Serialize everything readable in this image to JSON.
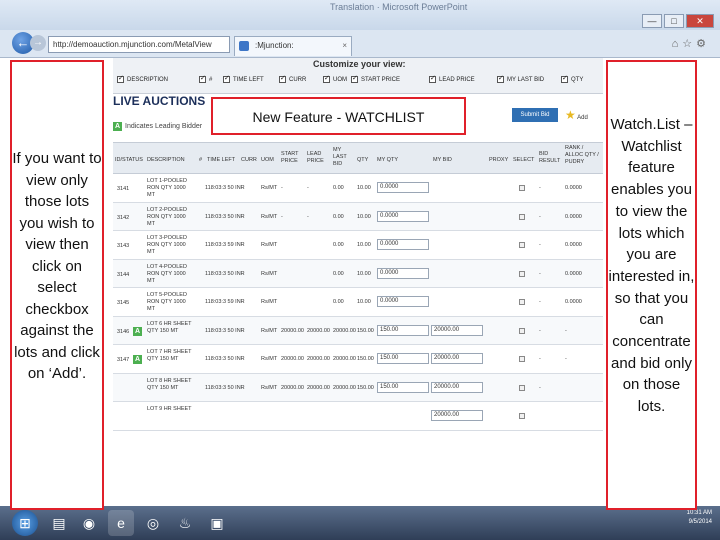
{
  "browser": {
    "window_title": "Translation · Microsoft PowerPoint",
    "address": "http://demoauction.mjunction.com/MetalView",
    "tab_title": ":Mjunction:",
    "win_min": "—",
    "win_max": "□",
    "win_close": "✕"
  },
  "customize": {
    "title": "Customize your view:",
    "options": [
      "DESCRIPTION",
      "#",
      "TIME LEFT",
      "CURR",
      "UOM",
      "START PRICE",
      "LEAD PRICE",
      "MY LAST BID",
      "QTY"
    ]
  },
  "page": {
    "live_auctions": "LIVE AUCTIONS",
    "leading_badge": "A",
    "indicates_leading": "Indicates Leading Bidder",
    "submit_bid": "Submit Bid",
    "add_label": "Add"
  },
  "table": {
    "headers": {
      "status": "ID/STATUS",
      "description": "DESCRIPTION",
      "hash": "#",
      "time_left": "TIME LEFT",
      "curr": "CURR",
      "uom": "UOM",
      "start_price": "START PRICE",
      "lead_price": "LEAD PRICE",
      "my_last_bid": "MY LAST BID",
      "qty": "QTY",
      "my_qty": "MY QTY",
      "my_bid": "MY BID",
      "proxy": "PROXY",
      "select": "SELECT",
      "bid_result": "BID RESULT",
      "rank": "RANK / ALLOC QTY / PUDRY"
    },
    "rows": [
      {
        "id": "3141",
        "badge": "",
        "desc1": "LOT 1-POOLED",
        "desc2": "RON QTY 1000",
        "desc3": "MT",
        "time": "118:03:3 50 INR",
        "uom": "Rs/MT",
        "start": "-",
        "lead": "-",
        "last": "0.00",
        "qty": "10.00",
        "myqty": "0.0000",
        "mybid": "",
        "result": "-",
        "rank": "0.0000"
      },
      {
        "id": "3142",
        "badge": "",
        "desc1": "LOT 2-POOLED",
        "desc2": "RON QTY 1000",
        "desc3": "MT",
        "time": "118:03:3 50 INR",
        "uom": "Rs/MT",
        "start": "-",
        "lead": "-",
        "last": "0.00",
        "qty": "10.00",
        "myqty": "0.0000",
        "mybid": "",
        "result": "-",
        "rank": "0.0000"
      },
      {
        "id": "3143",
        "badge": "",
        "desc1": "LOT 3-POOLED",
        "desc2": "RON QTY 1000",
        "desc3": "MT",
        "time": "118:03:3 59 INR",
        "uom": "Rs/MT",
        "start": "",
        "lead": "",
        "last": "0.00",
        "qty": "10.00",
        "myqty": "0.0000",
        "mybid": "",
        "result": "-",
        "rank": "0.0000"
      },
      {
        "id": "3144",
        "badge": "",
        "desc1": "LOT 4-POOLED",
        "desc2": "RON QTY 1000",
        "desc3": "MT",
        "time": "118:03:3 50 INR",
        "uom": "Rs/MT",
        "start": "",
        "lead": "",
        "last": "0.00",
        "qty": "10.00",
        "myqty": "0.0000",
        "mybid": "",
        "result": "-",
        "rank": "0.0000"
      },
      {
        "id": "3145",
        "badge": "",
        "desc1": "LOT 5-POOLED",
        "desc2": "RON QTY 1000",
        "desc3": "MT",
        "time": "118:03:3 59 INR",
        "uom": "Rs/MT",
        "start": "",
        "lead": "",
        "last": "0.00",
        "qty": "10.00",
        "myqty": "0.0000",
        "mybid": "",
        "result": "-",
        "rank": "0.0000"
      },
      {
        "id": "3146",
        "badge": "A",
        "desc1": "LOT 6 HR SHEET",
        "desc2": "QTY 150 MT",
        "desc3": "",
        "time": "118:03:3 50 INR",
        "uom": "Rs/MT",
        "start": "20000.00",
        "lead": "20000.00",
        "last": "20000.00",
        "qty": "150.00",
        "myqty": "150.00",
        "mybid": "20000.00",
        "result": "-",
        "rank": "-"
      },
      {
        "id": "3147",
        "badge": "A",
        "desc1": "LOT 7 HR SHEET",
        "desc2": "QTY 150 MT",
        "desc3": "",
        "time": "118:03:3 50 INR",
        "uom": "Rs/MT",
        "start": "20000.00",
        "lead": "20000.00",
        "last": "20000.00",
        "qty": "150.00",
        "myqty": "150.00",
        "mybid": "20000.00",
        "result": "-",
        "rank": "-"
      },
      {
        "id": "",
        "badge": "",
        "desc1": "LOT 8 HR SHEET",
        "desc2": "QTY 150 MT",
        "desc3": "",
        "time": "118:03:3 50 INR",
        "uom": "Rs/MT",
        "start": "20000.00",
        "lead": "20000.00",
        "last": "20000.00",
        "qty": "150.00",
        "myqty": "150.00",
        "mybid": "20000.00",
        "result": "-",
        "rank": ""
      },
      {
        "id": "",
        "badge": "",
        "desc1": "LOT 9 HR SHEET",
        "desc2": "",
        "desc3": "",
        "time": "",
        "uom": "",
        "start": "",
        "lead": "",
        "last": "",
        "qty": "",
        "myqty": "",
        "mybid": "20000.00",
        "result": "",
        "rank": ""
      }
    ]
  },
  "taskbar": {
    "time": "10:31 AM",
    "date": "9/5/2014"
  },
  "callouts": {
    "feature_title": "New Feature - WATCHLIST",
    "left_text": "If you want to view only those lots you wish to view then click on select checkbox against the lots and click on ‘Add’.",
    "right_text": "Watch.List – Watchlist feature enables you to view the lots which you are interested in, so that you can concentrate and bid only on those lots."
  },
  "colors": {
    "callout_border": "#e0202a",
    "leading_green": "#4caf50",
    "submit_blue": "#2f6fb3"
  }
}
